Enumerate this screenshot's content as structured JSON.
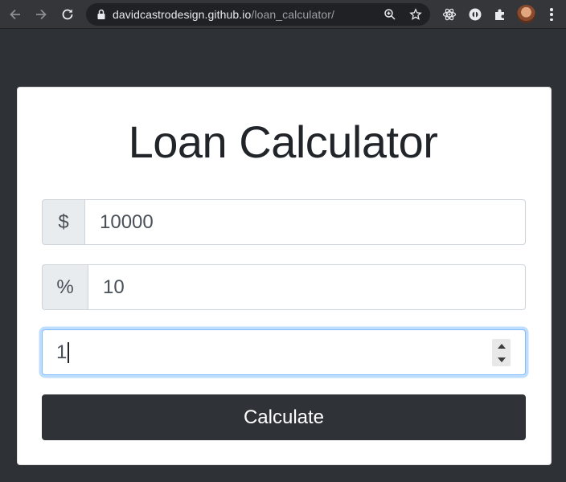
{
  "browser": {
    "url_host": "davidcastrodesign.github.io",
    "url_path": "/loan_calculator/"
  },
  "page": {
    "title": "Loan Calculator",
    "amount": {
      "addon": "$",
      "value": "10000"
    },
    "interest": {
      "addon": "%",
      "value": "10"
    },
    "years": {
      "value": "1"
    },
    "calculate_label": "Calculate"
  },
  "colors": {
    "page_background": "#2e3136",
    "button_background": "#2f3338",
    "focus_border": "#80bdff"
  }
}
